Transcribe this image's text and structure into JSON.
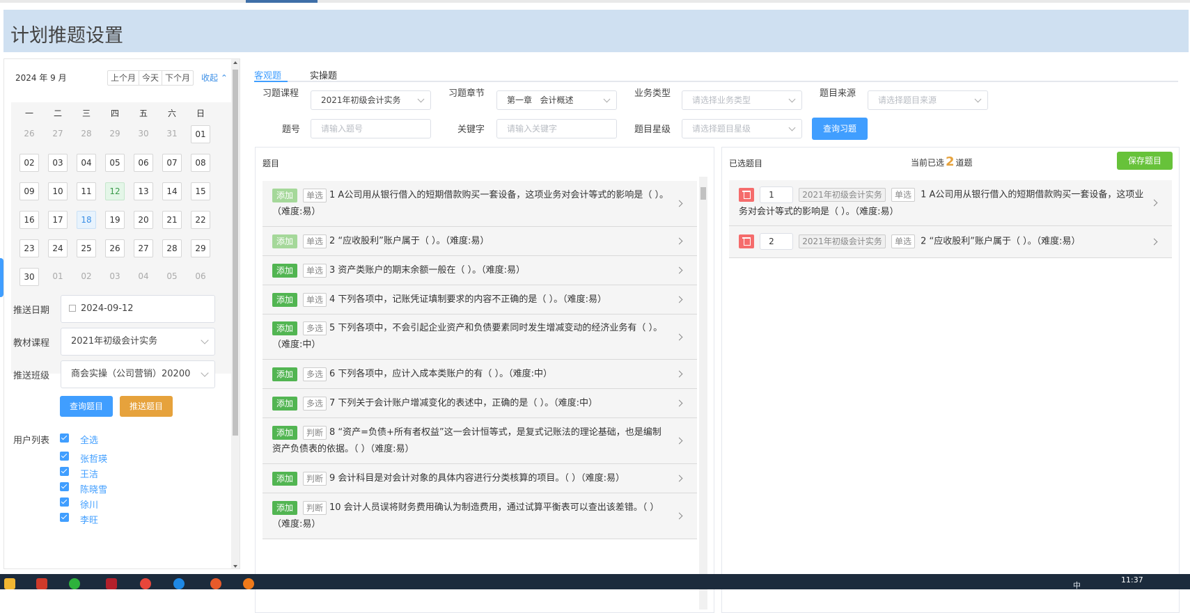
{
  "page": {
    "title": "计划推题设置"
  },
  "calendar": {
    "month_label": "2024 年 9 月",
    "prev_month": "上个月",
    "today": "今天",
    "next_month": "下个月",
    "collapse": "收起",
    "weekdays": [
      "一",
      "二",
      "三",
      "四",
      "五",
      "六",
      "日"
    ],
    "rows": [
      [
        "26",
        "27",
        "28",
        "29",
        "30",
        "31",
        "01"
      ],
      [
        "02",
        "03",
        "04",
        "05",
        "06",
        "07",
        "08"
      ],
      [
        "09",
        "10",
        "11",
        "12",
        "13",
        "14",
        "15"
      ],
      [
        "16",
        "17",
        "18",
        "19",
        "20",
        "21",
        "22"
      ],
      [
        "23",
        "24",
        "25",
        "26",
        "27",
        "28",
        "29"
      ],
      [
        "30",
        "01",
        "02",
        "03",
        "04",
        "05",
        "06"
      ]
    ]
  },
  "left_form": {
    "push_date_label": "推送日期",
    "push_date_value": "2024-09-12",
    "course_label": "教材课程",
    "course_value": "2021年初级会计实务",
    "class_label": "推送班级",
    "class_value": "商会实操（公司营销）20200",
    "query_button": "查询题目",
    "push_button": "推送题目",
    "user_list_label": "用户列表",
    "select_all": "全选",
    "users": [
      "张哲瑛",
      "王洁",
      "陈晓雪",
      "徐川",
      "李旺"
    ]
  },
  "tabs": {
    "objective": "客观题",
    "practical": "实操题"
  },
  "filters": {
    "course_label": "习题课程",
    "course_value": "2021年初级会计实务",
    "chapter_label": "习题章节",
    "chapter_value": "第一章   会计概述",
    "biz_type_label": "业务类型",
    "biz_type_placeholder": "请选择业务类型",
    "source_label": "题目来源",
    "source_placeholder": "请选择题目来源",
    "qno_label": "题号",
    "qno_placeholder": "请输入题号",
    "keyword_label": "关键字",
    "keyword_placeholder": "请输入关键字",
    "star_label": "题目星级",
    "star_placeholder": "请选择题目星级",
    "query_button": "查询习题"
  },
  "question_panel": {
    "title": "题目",
    "add_label": "添加",
    "items": [
      {
        "type": "单选",
        "text": "1 A公司用从银行借入的短期借款购买一套设备，这项业务对会计等式的影响是（ ）。（难度:易）"
      },
      {
        "type": "单选",
        "text": "2 “应收股利”账户属于（ ）。（难度:易）"
      },
      {
        "type": "单选",
        "text": "3 资产类账户的期末余额一般在（ ）。（难度:易）"
      },
      {
        "type": "单选",
        "text": "4 下列各项中，记账凭证填制要求的内容不正确的是（ ）。（难度:易）"
      },
      {
        "type": "多选",
        "text": "5 下列各项中，不会引起企业资产和负债要素同时发生增减变动的经济业务有（ ）。（难度:中）"
      },
      {
        "type": "多选",
        "text": "6 下列各项中，应计入成本类账户的有（ ）。（难度:中）"
      },
      {
        "type": "多选",
        "text": "7 下列关于会计账户增减变化的表述中，正确的是（ ）。（难度:中）"
      },
      {
        "type": "判断",
        "text": "8 “资产=负债+所有者权益”这一会计恒等式，是复式记账法的理论基础，也是编制资产负债表的依据。（ ）（难度:易）"
      },
      {
        "type": "判断",
        "text": "9 会计科目是对会计对象的具体内容进行分类核算的项目。（ ）（难度:易）"
      },
      {
        "type": "判断",
        "text": "10 会计人员误将财务费用确认为制造费用，通过试算平衡表可以查出该差错。（ ）（难度:易）"
      }
    ]
  },
  "selected_panel": {
    "title": "已选题目",
    "count_prefix": "当前已选",
    "count": "2",
    "count_suffix": "道题",
    "save_button": "保存题目",
    "items": [
      {
        "order": "1",
        "course": "2021年初级会计实务",
        "type": "单选",
        "text": "1 A公司用从银行借入的短期借款购买一套设备，这项业务对会计等式的影响是（ ）。（难度:易）"
      },
      {
        "order": "2",
        "course": "2021年初级会计实务",
        "type": "单选",
        "text": "2 “应收股利”账户属于（ ）。（难度:易）"
      }
    ]
  },
  "taskbar": {
    "time": "11:37",
    "ime": "中"
  }
}
